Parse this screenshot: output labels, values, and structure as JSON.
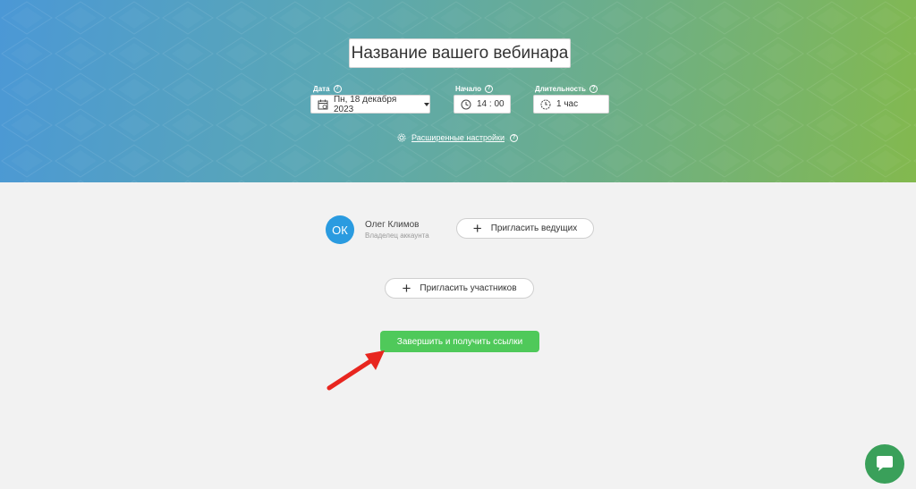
{
  "header": {
    "webinar_title": "Название вашего вебинара",
    "date_label": "Дата",
    "date_value": "Пн, 18 декабря 2023",
    "start_label": "Начало",
    "start_value": "14 : 00",
    "duration_label": "Длительность",
    "duration_value": "1 час",
    "advanced_settings": "Расширенные настройки",
    "help_glyph": "?"
  },
  "host": {
    "initials": "ОК",
    "name": "Олег Климов",
    "role": "Владелец аккаунта",
    "invite_hosts_label": "Пригласить ведущих"
  },
  "participants": {
    "invite_label": "Пригласить участников"
  },
  "actions": {
    "finish_label": "Завершить и получить ссылки"
  },
  "colors": {
    "finish_button": "#4fc95a",
    "avatar": "#2a9be0",
    "chat_button": "#3aa05a",
    "annotation_arrow": "#e8261f"
  },
  "icons": [
    "calendar-icon",
    "clock-icon",
    "timer-icon",
    "gear-icon",
    "help-icon",
    "plus-icon",
    "chat-icon",
    "arrow-annotation"
  ]
}
